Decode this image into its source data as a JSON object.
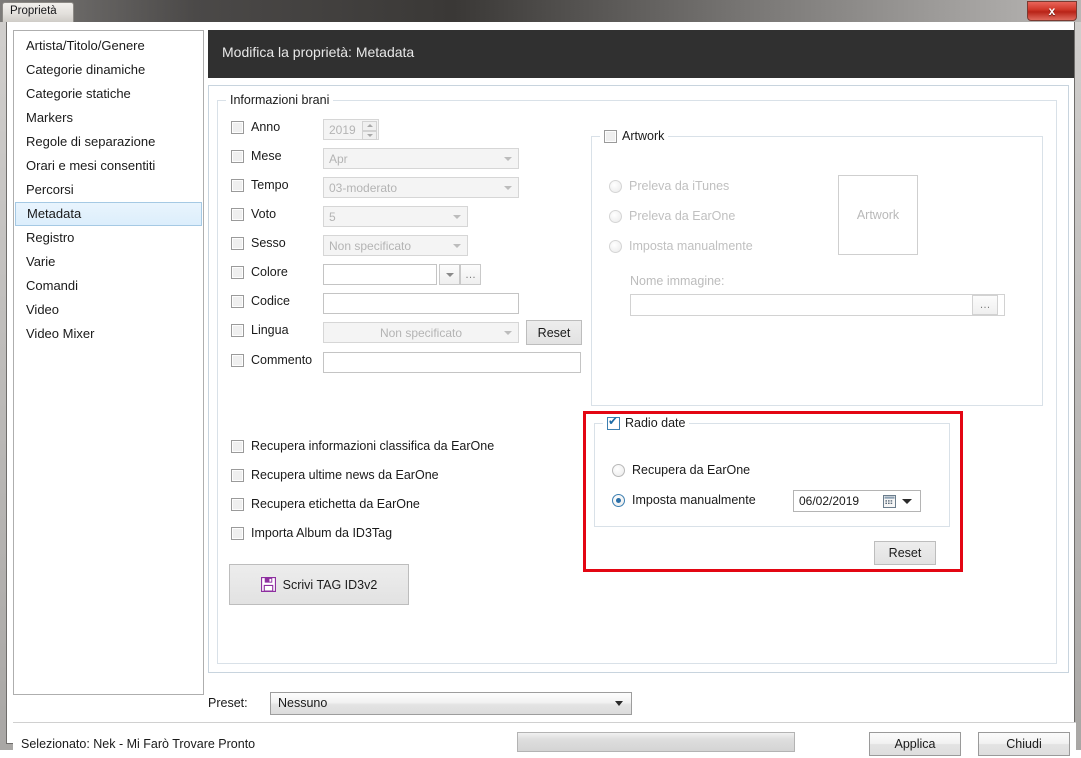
{
  "window": {
    "tab_title": "Proprietà",
    "close_label": "x"
  },
  "sidebar": {
    "items": [
      {
        "label": "Artista/Titolo/Genere",
        "selected": false
      },
      {
        "label": "Categorie dinamiche",
        "selected": false
      },
      {
        "label": "Categorie statiche",
        "selected": false
      },
      {
        "label": "Markers",
        "selected": false
      },
      {
        "label": "Regole di separazione",
        "selected": false
      },
      {
        "label": "Orari e mesi consentiti",
        "selected": false
      },
      {
        "label": "Percorsi",
        "selected": false
      },
      {
        "label": "Metadata",
        "selected": true
      },
      {
        "label": "Registro",
        "selected": false
      },
      {
        "label": "Varie",
        "selected": false
      },
      {
        "label": "Comandi",
        "selected": false
      },
      {
        "label": "Video",
        "selected": false
      },
      {
        "label": "Video Mixer",
        "selected": false
      }
    ]
  },
  "header": {
    "title": "Modifica la proprietà: Metadata"
  },
  "info_group": {
    "caption": "Informazioni brani",
    "rows": [
      {
        "label": "Anno",
        "value": "2019",
        "checked": false
      },
      {
        "label": "Mese",
        "value": "Apr",
        "checked": false
      },
      {
        "label": "Tempo",
        "value": "03-moderato",
        "checked": false
      },
      {
        "label": "Voto",
        "value": "5",
        "checked": false
      },
      {
        "label": "Sesso",
        "value": "Non specificato",
        "checked": false
      },
      {
        "label": "Colore",
        "value": "",
        "checked": false
      },
      {
        "label": "Codice",
        "value": "",
        "checked": false
      },
      {
        "label": "Lingua",
        "value": "Non specificato",
        "checked": false
      },
      {
        "label": "Commento",
        "value": "",
        "checked": false
      }
    ],
    "lingua_reset_label": "Reset",
    "colore_ellipsis": "…"
  },
  "extra_checks": [
    {
      "label": "Recupera informazioni classifica da EarOne",
      "checked": false
    },
    {
      "label": "Recupera ultime news da EarOne",
      "checked": false
    },
    {
      "label": "Recupera etichetta da EarOne",
      "checked": false
    },
    {
      "label": "Importa Album da ID3Tag",
      "checked": false
    }
  ],
  "write_tag_button": {
    "label": "Scrivi TAG ID3v2",
    "icon": "save-icon",
    "icon_color": "#8e2fa0"
  },
  "artwork_group": {
    "caption": "Artwork",
    "checked": false,
    "options": [
      {
        "label": "Preleva da iTunes",
        "selected": false
      },
      {
        "label": "Preleva da EarOne",
        "selected": false
      },
      {
        "label": "Imposta manualmente",
        "selected": false
      }
    ],
    "image_name_label": "Nome immagine:",
    "image_name_value": "",
    "browse_label": "…",
    "thumb_placeholder": "Artwork"
  },
  "radio_date_group": {
    "caption": "Radio date",
    "checked": true,
    "highlight_color": "#e30613",
    "options": [
      {
        "label": "Recupera da EarOne",
        "selected": false
      },
      {
        "label": "Imposta manualmente",
        "selected": true
      }
    ],
    "date_value": "06/02/2019",
    "date_icon": "calendar-icon",
    "reset_label": "Reset"
  },
  "preset": {
    "label": "Preset:",
    "value": "Nessuno"
  },
  "status": {
    "text": "Selezionato: Nek - Mi Farò Trovare Pronto",
    "progress_percent": 0
  },
  "footer_buttons": {
    "apply": "Applica",
    "close": "Chiudi"
  }
}
